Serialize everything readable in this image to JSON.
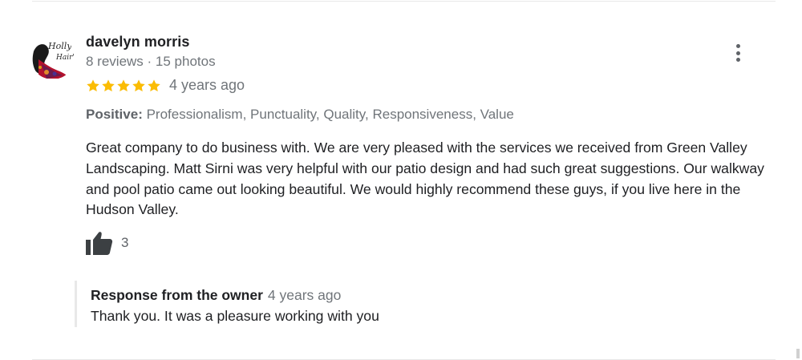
{
  "review": {
    "author": {
      "name": "davelyn morris",
      "meta": "8 reviews · 15 photos",
      "avatar_icon": "profile-photo-icon",
      "avatar_text": "Holly Hair's"
    },
    "rating": {
      "stars": 5,
      "max_stars": 5,
      "star_color": "#fbbc04"
    },
    "date": "4 years ago",
    "attributes": {
      "label": "Positive:",
      "values": "Professionalism, Punctuality, Quality, Responsiveness, Value"
    },
    "text": "Great company to do business with. We are very pleased with the services we received from Green Valley Landscaping. Matt Sirni was very helpful with our patio design and had such great suggestions. Our walkway and pool patio came out looking beautiful. We would highly recommend these guys, if you live here in the Hudson Valley.",
    "likes": {
      "count": "3",
      "icon": "thumbs-up-icon"
    },
    "more_icon": "more-vert-icon"
  },
  "owner_response": {
    "title": "Response from the owner",
    "date": "4 years ago",
    "text": "Thank you. It was a pleasure working with you"
  }
}
